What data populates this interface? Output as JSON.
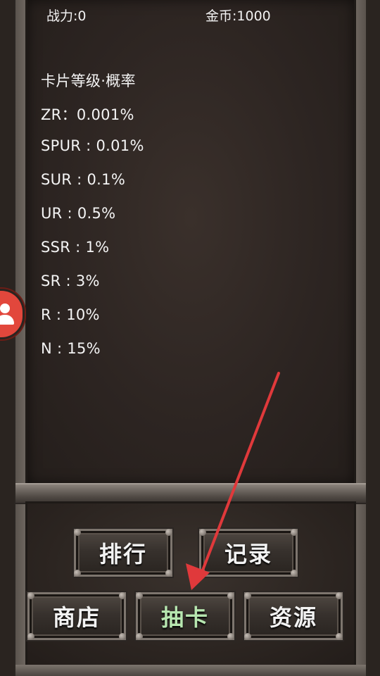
{
  "header": {
    "power": "战力:0",
    "gold": "金币:1000"
  },
  "rates": {
    "title": "卡片等级·概率",
    "items": [
      "ZR：0.001%",
      "SPUR : 0.01%",
      "SUR : 0.1%",
      "UR : 0.5%",
      "SSR : 1%",
      "SR : 3%",
      "R : 10%",
      "N : 15%"
    ]
  },
  "buttons": {
    "rank": "排行",
    "record": "记录",
    "shop": "商店",
    "draw": "抽卡",
    "resource": "资源"
  },
  "colors": {
    "active_text": "#b7e7b0",
    "arrow": "#e0393b",
    "avatar": "#e2473c"
  },
  "icons": {
    "avatar": "user-icon",
    "pointer": "red-arrow"
  }
}
